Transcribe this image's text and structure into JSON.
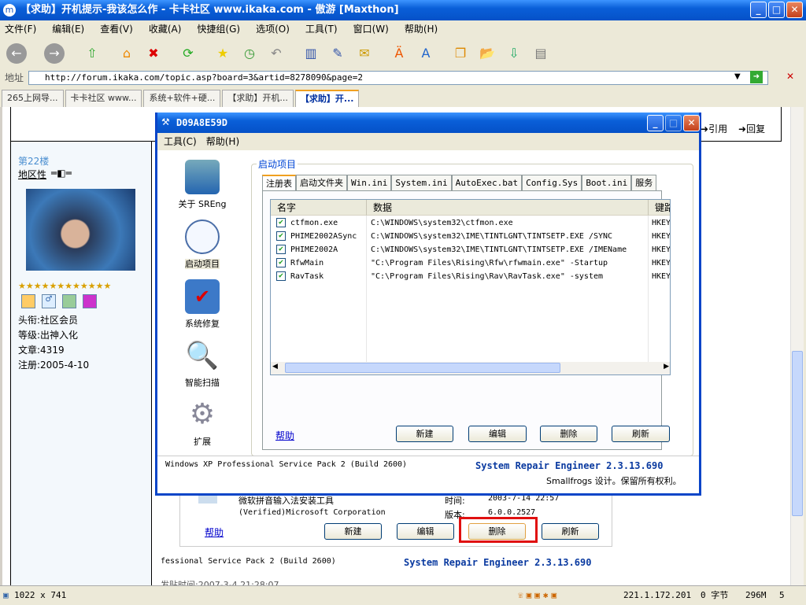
{
  "window": {
    "title": "【求助】开机提示-我该怎么作 - 卡卡社区 www.ikaka.com - 傲游 [Maxthon]",
    "app_icon": "m"
  },
  "menu": [
    "文件(F)",
    "编辑(E)",
    "查看(V)",
    "收藏(A)",
    "快捷组(G)",
    "选项(O)",
    "工具(T)",
    "窗口(W)",
    "帮助(H)"
  ],
  "address": {
    "label": "地址",
    "url": "http://forum.ikaka.com/topic.asp?board=3&artid=8278090&page=2"
  },
  "tabs": [
    "265上网导...",
    "卡卡社区 www...",
    "系统+软件+硬...",
    "【求助】开机...",
    "【求助】开..."
  ],
  "forum": {
    "floor": "第22楼",
    "username": "地区性",
    "title": "头衔:社区会员",
    "level": "等级:出神入化",
    "posts": "文章:4319",
    "registered": "注册:2005-4-10",
    "quote": "引用",
    "reply": "回复",
    "post_time": "发贴时间:2007-3-4 21:28:07"
  },
  "background_panel": {
    "software_name": "微软拼音输入法安装工具",
    "publisher": "(Verified)Microsoft Corporation",
    "time_label": "时间:",
    "time_value": "2003-7-14 22:57",
    "version_label": "版本:",
    "version_value": "6.0.0.2527",
    "help": "帮助",
    "buttons": [
      "新建",
      "编辑",
      "删除",
      "刷新"
    ],
    "footer_left": "fessional Service Pack 2 (Build 2600)",
    "footer_right": "System Repair Engineer 2.3.13.690"
  },
  "dialog": {
    "title": "D09A8E59D",
    "menu": [
      "工具(C)",
      "帮助(H)"
    ],
    "nav": [
      "关于 SREng",
      "启动项目",
      "系统修复",
      "智能扫描",
      "扩展"
    ],
    "group_label": "启动项目",
    "tabs": [
      "注册表",
      "启动文件夹",
      "Win.ini",
      "System.ini",
      "AutoExec.bat",
      "Config.Sys",
      "Boot.ini",
      "服务"
    ],
    "columns": [
      "名字",
      "数据",
      "键路"
    ],
    "rows": [
      {
        "name": "ctfmon.exe",
        "data": "C:\\WINDOWS\\system32\\ctfmon.exe",
        "key": "HKEY",
        "checked": true
      },
      {
        "name": "PHIME2002ASync",
        "data": "C:\\WINDOWS\\system32\\IME\\TINTLGNT\\TINTSETP.EXE /SYNC",
        "key": "HKEY",
        "checked": true
      },
      {
        "name": "PHIME2002A",
        "data": "C:\\WINDOWS\\system32\\IME\\TINTLGNT\\TINTSETP.EXE /IMEName",
        "key": "HKEY",
        "checked": true
      },
      {
        "name": "RfwMain",
        "data": "\"C:\\Program Files\\Rising\\Rfw\\rfwmain.exe\" -Startup",
        "key": "HKEY",
        "checked": true
      },
      {
        "name": "RavTask",
        "data": "\"C:\\Program Files\\Rising\\Rav\\RavTask.exe\" -system",
        "key": "HKEY",
        "checked": true
      }
    ],
    "help": "帮助",
    "buttons": [
      "新建",
      "编辑",
      "删除",
      "刷新"
    ],
    "os": "Windows XP Professional Service Pack 2 (Build 2600)",
    "product": "System Repair Engineer 2.3.13.690",
    "copyright": "Smallfrogs 设计。保留所有权利。"
  },
  "status": {
    "size": "1022 x 741",
    "ip": "221.1.172.201",
    "bytes": "0 字节",
    "memory": "296M",
    "count": "5"
  },
  "colors": {
    "xp_blue": "#0a5fd8",
    "highlight": "#e01010"
  }
}
